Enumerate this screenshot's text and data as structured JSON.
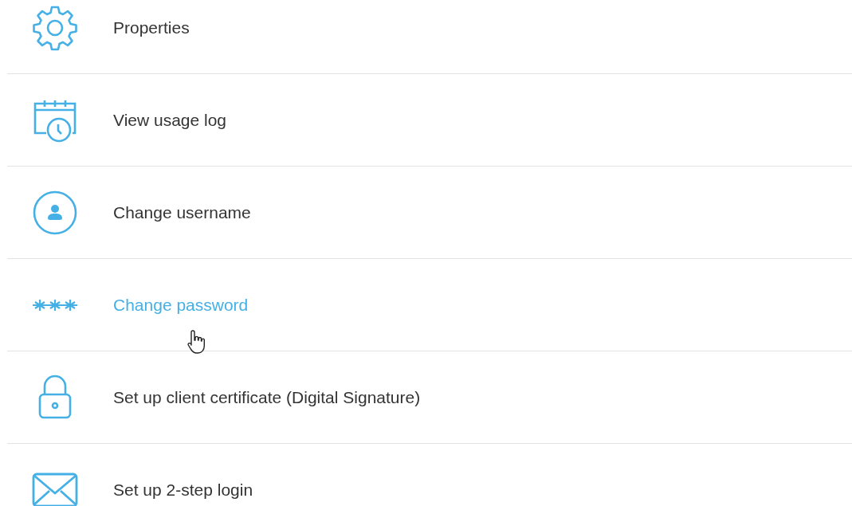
{
  "menu": {
    "items": [
      {
        "label": "Properties",
        "hovered": false
      },
      {
        "label": "View usage log",
        "hovered": false
      },
      {
        "label": "Change username",
        "hovered": false
      },
      {
        "label": "Change password",
        "hovered": true
      },
      {
        "label": "Set up client certificate (Digital Signature)",
        "hovered": false
      },
      {
        "label": "Set up 2-step login",
        "hovered": false
      }
    ]
  }
}
